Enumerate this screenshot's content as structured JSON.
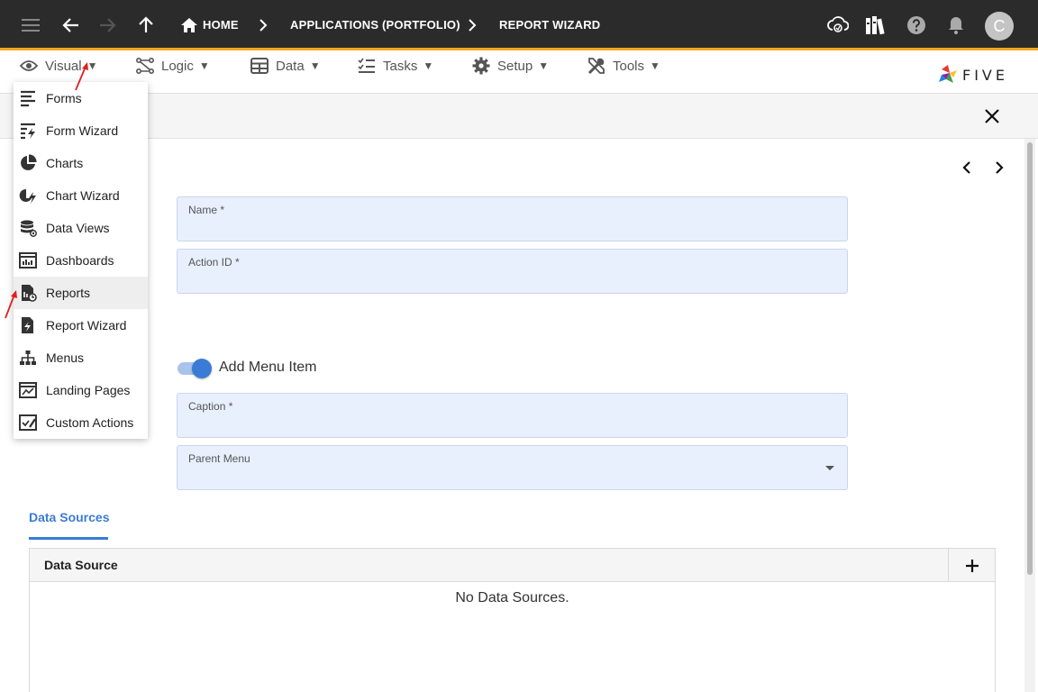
{
  "topbar": {
    "breadcrumbs": [
      "HOME",
      "APPLICATIONS (PORTFOLIO)",
      "REPORT WIZARD"
    ],
    "avatar_initial": "C"
  },
  "menubar": {
    "items": [
      {
        "label": "Visual",
        "icon": "eye-icon"
      },
      {
        "label": "Logic",
        "icon": "logic-icon"
      },
      {
        "label": "Data",
        "icon": "table-icon"
      },
      {
        "label": "Tasks",
        "icon": "tasks-icon"
      },
      {
        "label": "Setup",
        "icon": "gear-icon"
      },
      {
        "label": "Tools",
        "icon": "tools-icon"
      }
    ],
    "caret": "▼",
    "logo_text": "FIVE"
  },
  "dropdown": {
    "items": [
      {
        "label": "Forms",
        "icon": "forms-icon"
      },
      {
        "label": "Form Wizard",
        "icon": "form-wizard-icon"
      },
      {
        "label": "Charts",
        "icon": "charts-icon"
      },
      {
        "label": "Chart Wizard",
        "icon": "chart-wizard-icon"
      },
      {
        "label": "Data Views",
        "icon": "data-views-icon"
      },
      {
        "label": "Dashboards",
        "icon": "dashboards-icon"
      },
      {
        "label": "Reports",
        "icon": "reports-icon",
        "active": true
      },
      {
        "label": "Report Wizard",
        "icon": "report-wizard-icon"
      },
      {
        "label": "Menus",
        "icon": "menus-icon"
      },
      {
        "label": "Landing Pages",
        "icon": "landing-pages-icon"
      },
      {
        "label": "Custom Actions",
        "icon": "custom-actions-icon"
      }
    ]
  },
  "form": {
    "name_label": "Name *",
    "name_value": "",
    "action_id_label": "Action ID *",
    "action_id_value": "",
    "add_menu_item_label": "Add Menu Item",
    "add_menu_item_on": true,
    "caption_label": "Caption *",
    "caption_value": "",
    "parent_menu_label": "Parent Menu",
    "parent_menu_value": ""
  },
  "data_sources": {
    "tab_label": "Data Sources",
    "column_header": "Data Source",
    "empty_text": "No Data Sources."
  },
  "colors": {
    "topbar": "#2b2b2b",
    "accent_orange": "#f5a623",
    "field_bg": "#e8f0fe",
    "primary_blue": "#3a7bd5",
    "annotation_red": "#e02020"
  }
}
